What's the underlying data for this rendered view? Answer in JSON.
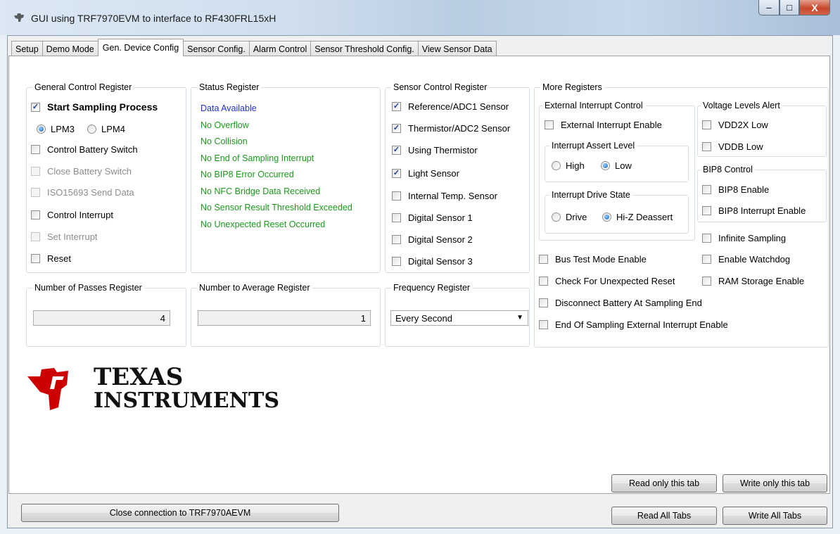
{
  "window": {
    "title": "GUI using TRF7970EVM to interface to RF430FRL15xH",
    "minimize_glyph": "‒",
    "maximize_glyph": "□",
    "close_glyph": "X",
    "app_icon": "ti-logo-icon"
  },
  "tabs": [
    "Setup",
    "Demo Mode",
    "Gen. Device Config",
    "Sensor Config.",
    "Alarm Control",
    "Sensor Threshold Config.",
    "View Sensor Data"
  ],
  "active_tab": "Gen. Device Config",
  "general_control": {
    "title": "General Control Register",
    "start_sampling": "Start Sampling Process",
    "lpm3": "LPM3",
    "lpm4": "LPM4",
    "control_battery_switch": "Control Battery Switch",
    "close_battery_switch": "Close Battery Switch",
    "iso15693_send": "ISO15693 Send Data",
    "control_interrupt": "Control Interrupt",
    "set_interrupt": "Set Interrupt",
    "reset": "Reset"
  },
  "status_register": {
    "title": "Status Register",
    "items": [
      {
        "text": "Data Available",
        "color": "#2233cc"
      },
      {
        "text": "No Overflow",
        "color": "#1a9a1a"
      },
      {
        "text": "No Collision",
        "color": "#1a9a1a"
      },
      {
        "text": "No End of Sampling Interrupt",
        "color": "#1a9a1a"
      },
      {
        "text": "No BIP8 Error Occurred",
        "color": "#1a9a1a"
      },
      {
        "text": "No NFC Bridge Data Received",
        "color": "#1a9a1a"
      },
      {
        "text": "No Sensor Result Threshold Exceeded",
        "color": "#1a9a1a"
      },
      {
        "text": "No Unexpected Reset Occurred",
        "color": "#1a9a1a"
      }
    ]
  },
  "sensor_control": {
    "title": "Sensor Control Register",
    "items": [
      {
        "label": "Reference/ADC1 Sensor",
        "checked": true
      },
      {
        "label": "Thermistor/ADC2 Sensor",
        "checked": true
      },
      {
        "label": "Using Thermistor",
        "checked": true
      },
      {
        "label": "Light Sensor",
        "checked": true
      },
      {
        "label": "Internal Temp. Sensor",
        "checked": false
      },
      {
        "label": "Digital Sensor 1",
        "checked": false
      },
      {
        "label": "Digital Sensor 2",
        "checked": false
      },
      {
        "label": "Digital Sensor 3",
        "checked": false
      }
    ]
  },
  "more_registers": {
    "title": "More Registers",
    "ext_int_title": "External Interrupt Control",
    "ext_int_enable": "External Interrupt Enable",
    "assert_title": "Interrupt Assert Level",
    "high": "High",
    "low": "Low",
    "drive_title": "Interrupt Drive State",
    "drive": "Drive",
    "hiz": "Hi-Z Deassert",
    "voltage_title": "Voltage Levels Alert",
    "vdd2x": "VDD2X Low",
    "vddb": "VDDB Low",
    "bip8_title": "BIP8 Control",
    "bip8_enable": "BIP8 Enable",
    "bip8_int": "BIP8 Interrupt Enable",
    "infinite": "Infinite Sampling",
    "watchdog": "Enable Watchdog",
    "ram": "RAM Storage Enable",
    "bus_test": "Bus Test Mode Enable",
    "check_reset": "Check For Unexpected Reset",
    "disconnect": "Disconnect Battery At Sampling End",
    "eos_int": "End Of Sampling External Interrupt Enable"
  },
  "passes": {
    "title": "Number of Passes Register",
    "value": "4"
  },
  "average": {
    "title": "Number to Average Register",
    "value": "1"
  },
  "frequency": {
    "title": "Frequency Register",
    "value": "Every Second"
  },
  "logo": {
    "line1": "TEXAS",
    "line2": "INSTRUMENTS"
  },
  "buttons": {
    "read_tab": "Read only this tab",
    "write_tab": "Write only this tab",
    "close_conn": "Close connection to TRF7970AEVM",
    "read_all": "Read All Tabs",
    "write_all": "Write All Tabs"
  },
  "colors": {
    "ti_red": "#cc0000"
  }
}
